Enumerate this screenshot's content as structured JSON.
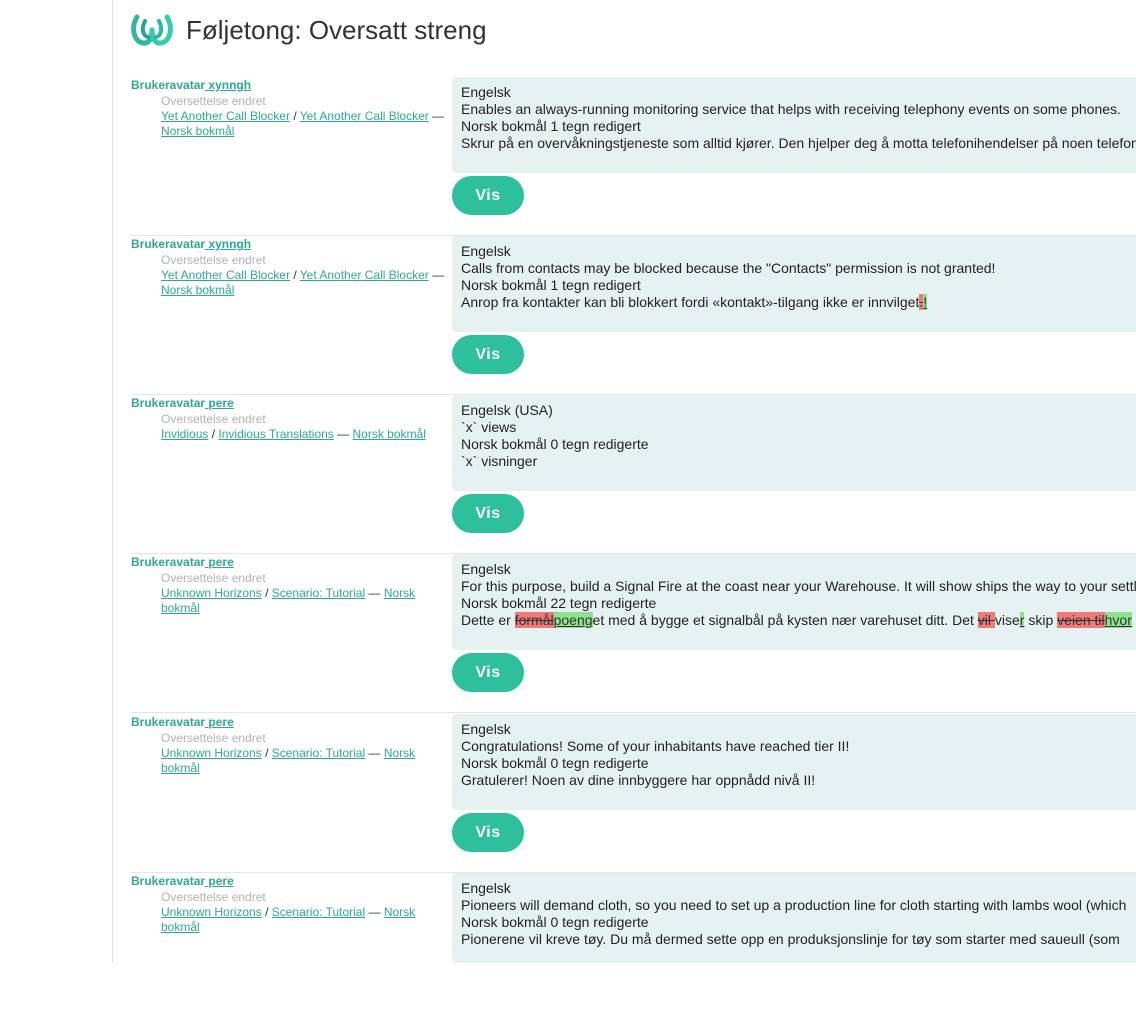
{
  "page": {
    "title": "Føljetong: Oversatt streng"
  },
  "labels": {
    "avatar": "Brukeravatar",
    "vis": "Vis",
    "sep": "/",
    "dash": "—"
  },
  "entries": [
    {
      "user": "xynngh",
      "action": "Oversettelse endret",
      "project": "Yet Another Call Blocker",
      "component": "Yet Another Call Blocker",
      "language": "Norsk bokmål",
      "source_lang": "Engelsk",
      "source": "Enables an always-running monitoring service that helps with receiving telephony events on some phones.",
      "target_lang": "Norsk bokmål 1 tegn redigert",
      "target": "Skrur på en overvåkningstjeneste som alltid kjører. Den hjelper deg å motta telefonihendelser på noen telefoner."
    },
    {
      "user": "xynngh",
      "action": "Oversettelse endret",
      "project": "Yet Another Call Blocker",
      "component": "Yet Another Call Blocker",
      "language": "Norsk bokmål",
      "source_lang": "Engelsk",
      "source": "Calls from contacts may be blocked because the \"Contacts\" permission is not granted!",
      "target_lang": "Norsk bokmål 1 tegn redigert",
      "target_prefix": "Anrop fra kontakter kan bli blokkert fordi «kontakt»-tilgang ikke er innvilget",
      "target_del": ".",
      "target_ins": "!"
    },
    {
      "user": "pere",
      "action": "Oversettelse endret",
      "project": "Invidious",
      "component": "Invidious Translations",
      "language": "Norsk bokmål",
      "source_lang": "Engelsk (USA)",
      "source": "`x` views",
      "target_lang": "Norsk bokmål 0 tegn redigerte",
      "target": "`x` visninger"
    },
    {
      "user": "pere",
      "action": "Oversettelse endret",
      "project": "Unknown Horizons",
      "component": "Scenario: Tutorial",
      "language": "Norsk bokmål",
      "source_lang": "Engelsk",
      "source": "For this purpose, build a Signal Fire at the coast near your Warehouse. It will show ships the way to your settlement.",
      "target_lang": "Norsk bokmål 22 tegn redigerte",
      "target_parts": {
        "p1": "Dette er ",
        "d1": "formål",
        "i1": "poeng",
        "p2": "et med å bygge et signalbål på kysten nær varehuset ditt. Det ",
        "d2": "vil ",
        "p3": "vise",
        "i2": "r",
        "p4": " skip ",
        "d3": "veien til",
        "i3": "hvor"
      }
    },
    {
      "user": "pere",
      "action": "Oversettelse endret",
      "project": "Unknown Horizons",
      "component": "Scenario: Tutorial",
      "language": "Norsk bokmål",
      "source_lang": "Engelsk",
      "source": "Congratulations! Some of your inhabitants have reached tier II!",
      "target_lang": "Norsk bokmål 0 tegn redigerte",
      "target": "Gratulerer! Noen av dine innbyggere har oppnådd nivå II!"
    },
    {
      "user": "pere",
      "action": "Oversettelse endret",
      "project": "Unknown Horizons",
      "component": "Scenario: Tutorial",
      "language": "Norsk bokmål",
      "source_lang": "Engelsk",
      "source": "Pioneers will demand cloth, so you need to set up a production line for cloth starting with lambs wool (which",
      "target_lang": "Norsk bokmål 0 tegn redigerte",
      "target": "Pionerene vil kreve tøy. Du må dermed sette opp en produksjonslinje for tøy som starter med saueull (som"
    }
  ]
}
